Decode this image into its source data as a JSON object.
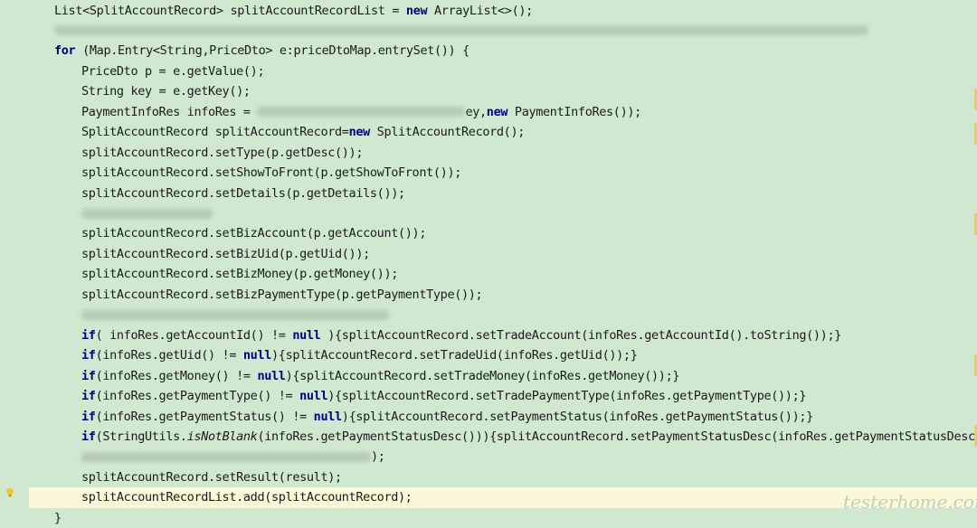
{
  "editor": {
    "lines": [
      {
        "indent": 1,
        "tokens": [
          [
            "t",
            "List<SplitAccountRecord> splitAccountRecordList = "
          ],
          [
            "k",
            "new"
          ],
          [
            "t",
            " ArrayList<>();"
          ]
        ]
      },
      {
        "indent": 1,
        "tokens": [
          [
            "b",
            ""
          ]
        ]
      },
      {
        "indent": 1,
        "tokens": [
          [
            "k",
            "for"
          ],
          [
            "t",
            " (Map.Entry<String,PriceDto> e:priceDtoMap.entrySet()) {"
          ]
        ]
      },
      {
        "indent": 2,
        "tokens": [
          [
            "t",
            "PriceDto p = e.getValue();"
          ]
        ]
      },
      {
        "indent": 2,
        "tokens": [
          [
            "t",
            "String key = e.getKey();"
          ]
        ]
      },
      {
        "indent": 2,
        "tokens": [
          [
            "t",
            "PaymentInfoRes infoRes = "
          ],
          [
            "b",
            ""
          ],
          [
            "t",
            "ey,"
          ],
          [
            "k",
            "new"
          ],
          [
            "t",
            " PaymentInfoRes());"
          ]
        ]
      },
      {
        "indent": 2,
        "tokens": [
          [
            "t",
            "SplitAccountRecord splitAccountRecord="
          ],
          [
            "k",
            "new"
          ],
          [
            "t",
            " SplitAccountRecord();"
          ]
        ]
      },
      {
        "indent": 2,
        "tokens": [
          [
            "t",
            "splitAccountRecord.setType(p.getDesc());"
          ]
        ]
      },
      {
        "indent": 2,
        "tokens": [
          [
            "t",
            "splitAccountRecord.setShowToFront(p.getShowToFront());"
          ]
        ]
      },
      {
        "indent": 2,
        "tokens": [
          [
            "t",
            "splitAccountRecord.setDetails(p.getDetails());"
          ]
        ]
      },
      {
        "indent": 2,
        "tokens": [
          [
            "b",
            ""
          ]
        ]
      },
      {
        "indent": 2,
        "tokens": [
          [
            "t",
            "splitAccountRecord.setBizAccount(p.getAccount());"
          ]
        ]
      },
      {
        "indent": 2,
        "tokens": [
          [
            "t",
            "splitAccountRecord.setBizUid(p.getUid());"
          ]
        ]
      },
      {
        "indent": 2,
        "tokens": [
          [
            "t",
            "splitAccountRecord.setBizMoney(p.getMoney());"
          ]
        ]
      },
      {
        "indent": 2,
        "tokens": [
          [
            "t",
            "splitAccountRecord.setBizPaymentType(p.getPaymentType());"
          ]
        ]
      },
      {
        "indent": 2,
        "tokens": [
          [
            "b",
            ""
          ]
        ]
      },
      {
        "indent": 2,
        "tokens": [
          [
            "k",
            "if"
          ],
          [
            "t",
            "( infoRes.getAccountId() != "
          ],
          [
            "k",
            "null"
          ],
          [
            "t",
            " ){splitAccountRecord.setTradeAccount(infoRes.getAccountId().toString());}"
          ]
        ]
      },
      {
        "indent": 2,
        "tokens": [
          [
            "k",
            "if"
          ],
          [
            "t",
            "(infoRes.getUid() != "
          ],
          [
            "k",
            "null"
          ],
          [
            "t",
            "){splitAccountRecord.setTradeUid(infoRes.getUid());}"
          ]
        ]
      },
      {
        "indent": 2,
        "tokens": [
          [
            "k",
            "if"
          ],
          [
            "t",
            "(infoRes.getMoney() != "
          ],
          [
            "k",
            "null"
          ],
          [
            "t",
            "){splitAccountRecord.setTradeMoney(infoRes.getMoney());}"
          ]
        ]
      },
      {
        "indent": 2,
        "tokens": [
          [
            "k",
            "if"
          ],
          [
            "t",
            "(infoRes.getPaymentType() != "
          ],
          [
            "k",
            "null"
          ],
          [
            "t",
            "){splitAccountRecord.setTradePaymentType(infoRes.getPaymentType());}"
          ]
        ]
      },
      {
        "indent": 2,
        "tokens": [
          [
            "k",
            "if"
          ],
          [
            "t",
            "(infoRes.getPaymentStatus() != "
          ],
          [
            "k",
            "null"
          ],
          [
            "t",
            "){splitAccountRecord.setPaymentStatus(infoRes.getPaymentStatus());}"
          ]
        ]
      },
      {
        "indent": 2,
        "tokens": [
          [
            "k",
            "if"
          ],
          [
            "t",
            "(StringUtils."
          ],
          [
            "i",
            "isNotBlank"
          ],
          [
            "t",
            "(infoRes.getPaymentStatusDesc())){splitAccountRecord.setPaymentStatusDesc(infoRes.getPaymentStatusDesc());}"
          ]
        ]
      },
      {
        "indent": 2,
        "tokens": [
          [
            "b",
            ""
          ],
          [
            "t",
            ");"
          ]
        ]
      },
      {
        "indent": 2,
        "tokens": [
          [
            "t",
            "splitAccountRecord.setResult(result);"
          ]
        ]
      },
      {
        "indent": 2,
        "current": true,
        "tokens": [
          [
            "t",
            "splitAccountRecordList.add(splitAccountRecord);"
          ]
        ]
      },
      {
        "indent": 1,
        "tokens": [
          [
            "t",
            "}"
          ]
        ]
      }
    ]
  },
  "gutter": {
    "intention_icon": "lightbulb-icon"
  },
  "watermark": {
    "text": "testerhome.com"
  },
  "colors": {
    "background": "#cfe8cf",
    "keyword": "#000080",
    "current_line": "#fbf7d9",
    "marker": "#e8cf58"
  }
}
